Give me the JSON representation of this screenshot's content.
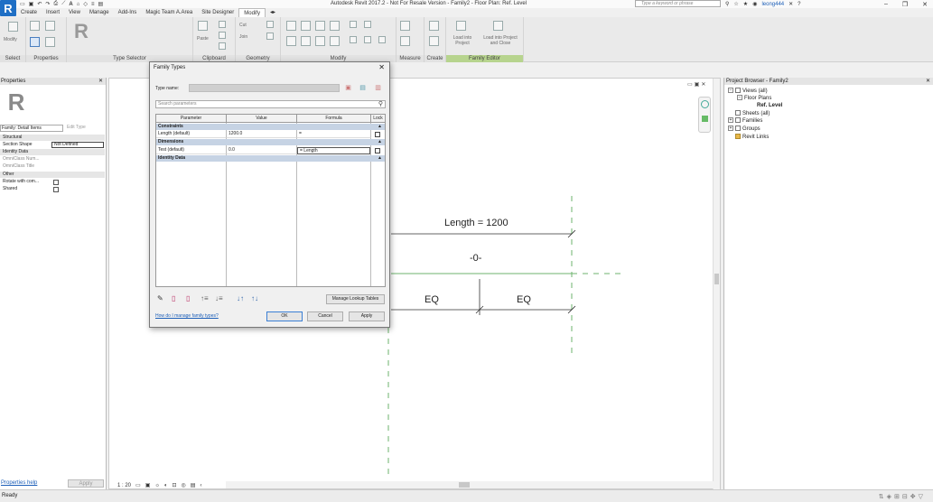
{
  "titlebar": {
    "app_letter": "R",
    "window_title": "Autodesk Revit 2017.2 -  Not For Resale Version -   Family2 - Floor Plan: Ref. Level",
    "search_placeholder": "Type a keyword or phrase",
    "username": "leong444"
  },
  "ribbon": {
    "tabs": [
      "Create",
      "Insert",
      "View",
      "Manage",
      "Add-Ins",
      "Magic Team A.Area",
      "Site Designer",
      "Modify"
    ],
    "active_tab": "Modify",
    "panels": {
      "select": "Select",
      "properties": "Properties",
      "type_selector": "Type Selector",
      "clipboard": "Clipboard",
      "geometry": "Geometry",
      "modify": "Modify",
      "measure": "Measure",
      "create": "Create",
      "family_editor": "Family Editor"
    },
    "buttons": {
      "modify": "Modify",
      "paste": "Paste",
      "cut": "Cut",
      "join": "Join",
      "load_into_project": "Load into Project",
      "load_into_project_close": "Load into Project and Close"
    }
  },
  "properties": {
    "title": "Properties",
    "family": "Family: Detail Items",
    "edit_type": "Edit Type",
    "rows": [
      {
        "label": "Structural",
        "group": true
      },
      {
        "label": "Section Shape",
        "value": "Not Defined"
      },
      {
        "label": "Identity Data",
        "group": true
      },
      {
        "label": "OmniClass Num...",
        "dim": true
      },
      {
        "label": "OmniClass Title",
        "dim": true
      },
      {
        "label": "Other",
        "group": true
      },
      {
        "label": "Rotate with com...",
        "checkbox": true
      },
      {
        "label": "Shared",
        "checkbox": true
      }
    ],
    "help_link": "Properties help",
    "apply": "Apply"
  },
  "canvas": {
    "dim_length": "Length = 1200",
    "dim_zero": "-0-",
    "eq_left": "EQ",
    "eq_right": "EQ",
    "scale": "1 : 20"
  },
  "browser": {
    "title": "Project Browser - Family2",
    "nodes": [
      "Views (all)",
      "Floor Plans",
      "Ref. Level",
      "Sheets (all)",
      "Families",
      "Groups",
      "Revit Links"
    ]
  },
  "status": {
    "text": "Ready"
  },
  "dialog": {
    "title": "Family Types",
    "type_name_label": "Type name:",
    "search_placeholder": "Search parameters",
    "headers": [
      "Parameter",
      "Value",
      "Formula",
      "Lock"
    ],
    "groups": {
      "constraints": "Constraints",
      "dimensions": "Dimensions",
      "identity": "Identity Data"
    },
    "rows": {
      "length": {
        "param": "Length (default)",
        "value": "1200.0",
        "formula": "="
      },
      "dim": {
        "param": "Test (default)",
        "value": "0.0",
        "formula": "= Length"
      }
    },
    "manage_lookup": "Manage Lookup Tables",
    "help_link": "How do I manage family types?",
    "ok": "OK",
    "cancel": "Cancel",
    "apply": "Apply"
  }
}
